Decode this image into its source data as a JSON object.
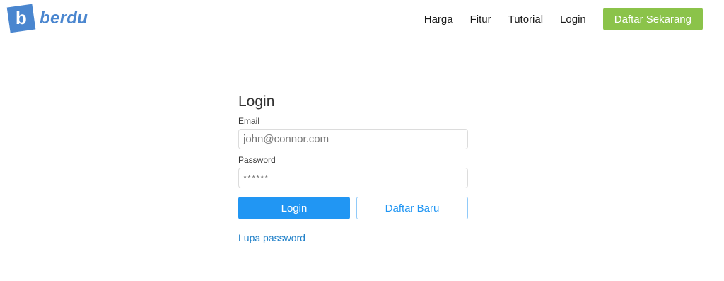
{
  "brand": {
    "logo_letter": "b",
    "name": "berdu",
    "color": "#4a86cf"
  },
  "nav": {
    "items": [
      {
        "label": "Harga"
      },
      {
        "label": "Fitur"
      },
      {
        "label": "Tutorial"
      },
      {
        "label": "Login"
      }
    ],
    "cta_label": "Daftar Sekarang",
    "cta_color": "#8bc34a"
  },
  "login_form": {
    "title": "Login",
    "email": {
      "label": "Email",
      "placeholder": "john@connor.com",
      "value": ""
    },
    "password": {
      "label": "Password",
      "placeholder": "******",
      "value": ""
    },
    "login_button": "Login",
    "register_button": "Daftar Baru",
    "forgot_link": "Lupa password",
    "primary_color": "#2196f3"
  }
}
